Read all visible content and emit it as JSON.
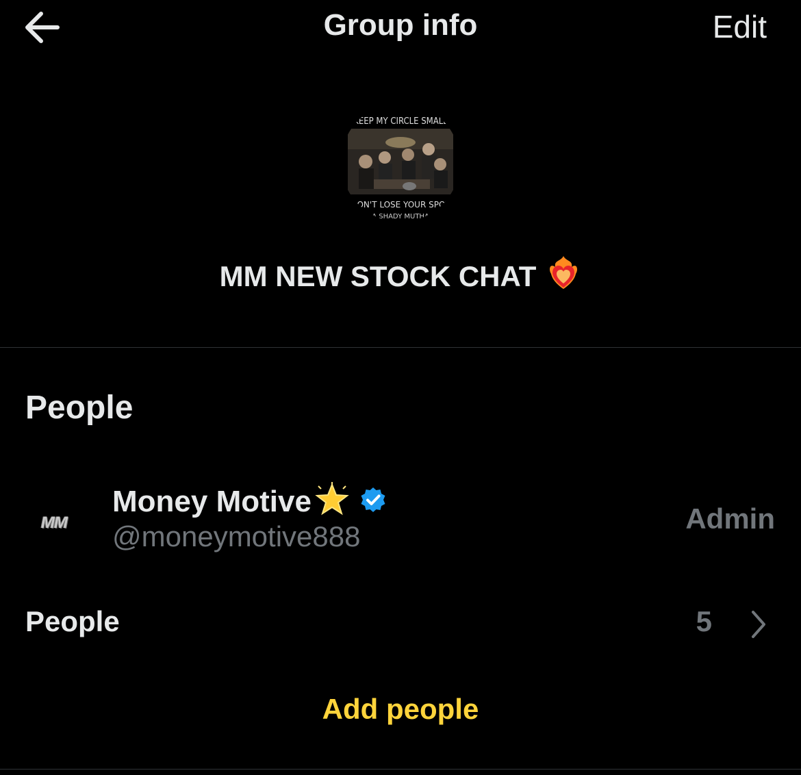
{
  "header": {
    "title": "Group info",
    "edit_label": "Edit",
    "back_icon": "arrow-left-icon"
  },
  "group": {
    "name": "MM NEW STOCK CHAT",
    "name_emoji": "heart-on-fire-icon",
    "avatar": {
      "top_text": "KEEP MY CIRCLE SMALL",
      "bottom_text": "DON'T LOSE YOUR SPOT",
      "bottom_text_2": "A SHADY MUTHA"
    }
  },
  "people_section": {
    "title": "People",
    "members": [
      {
        "avatar_text": "MM",
        "name": "Money Motive",
        "name_emoji": "glowing-star-icon",
        "verified": true,
        "handle": "@moneymotive888",
        "role": "Admin"
      }
    ],
    "people_row": {
      "label": "People",
      "count": "5"
    },
    "add_people_label": "Add people"
  },
  "colors": {
    "background": "#000000",
    "text_primary": "#e7e9ea",
    "text_secondary": "#71767b",
    "divider": "#2f3336",
    "accent_yellow": "#ffd43b",
    "verified_blue": "#1d9bf0"
  }
}
